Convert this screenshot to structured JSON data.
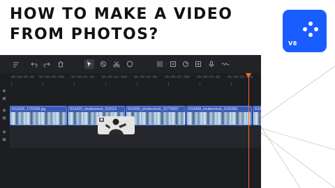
{
  "headline": {
    "line1": "HOW TO MAKE A VIDEO",
    "line2": "FROM PHOTOS?"
  },
  "logo": {
    "badge": "V8",
    "color": "#1a5dff",
    "icon": "four-dots-icon"
  },
  "toolbar": {
    "icons": [
      "add-track-icon",
      "undo-icon",
      "redo-icon",
      "delete-icon",
      "select-pointer-icon",
      "disable-icon",
      "scissors-icon",
      "shield-icon",
      "crop-icon",
      "sticker-icon",
      "speed-icon",
      "reverse-icon",
      "voice-icon",
      "link-icon"
    ],
    "selected": "select-pointer-icon"
  },
  "ruler": {
    "labels": [
      "00:00:00.00",
      "00:00:00.500",
      "00:00:01.00",
      "00:00:01.500",
      "00:00:02.00",
      "00:00:02.500",
      "00:00:03.00",
      "00:00:03.500"
    ]
  },
  "track": {
    "clips": [
      {
        "name": "RS2638_1725596.jpg"
      },
      {
        "name": "RS4225_shutterstock_510114"
      },
      {
        "name": "RS4290_shutterstock_15776097"
      },
      {
        "name": "RS4458_shutterstock_2239360"
      },
      {
        "name": "RS4"
      }
    ]
  },
  "colors": {
    "accent": "#1a5dff",
    "playhead": "#ff6a1a",
    "editor_bg": "#1d1e22",
    "clip": "#3e5bb4"
  }
}
